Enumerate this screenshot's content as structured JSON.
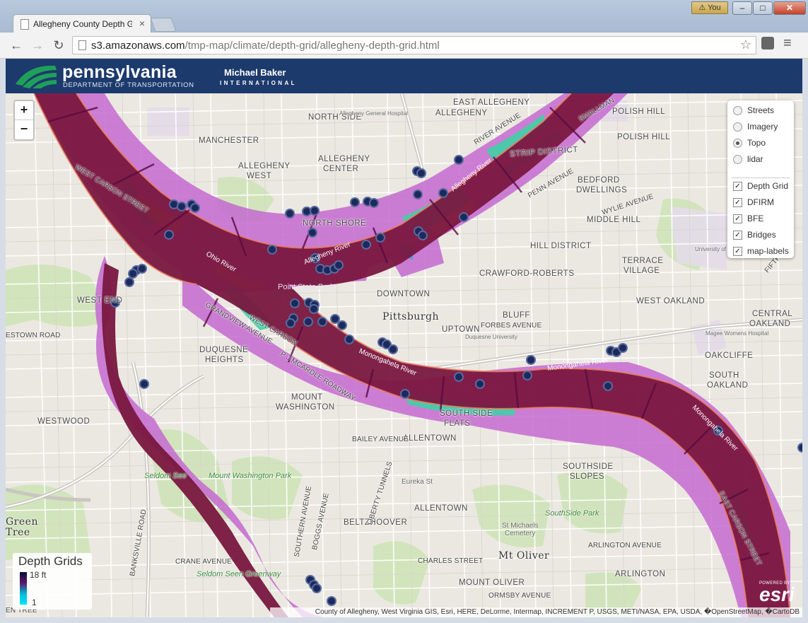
{
  "browser": {
    "tab_title": "Allegheny County Depth G",
    "profile_label": "You",
    "url_host": "s3.amazonaws.com",
    "url_path": "/tmp-map/climate/depth-grid/allegheny-depth-grid.html"
  },
  "banner": {
    "penndot_name": "pennsylvania",
    "penndot_dept": "DEPARTMENT OF TRANSPORTATION",
    "partner_name": "Michael Baker",
    "partner_sub": "INTERNATIONAL"
  },
  "zoom": {
    "in_label": "+",
    "out_label": "−"
  },
  "layers": {
    "basemaps": [
      {
        "label": "Streets",
        "selected": false
      },
      {
        "label": "Imagery",
        "selected": false
      },
      {
        "label": "Topo",
        "selected": true
      },
      {
        "label": "lidar",
        "selected": false
      }
    ],
    "overlays": [
      {
        "label": "Depth Grid",
        "checked": true
      },
      {
        "label": "DFIRM",
        "checked": true
      },
      {
        "label": "BFE",
        "checked": true
      },
      {
        "label": "Bridges",
        "checked": true
      },
      {
        "label": "map-labels",
        "checked": true
      }
    ]
  },
  "legend": {
    "title": "Depth Grids",
    "max": "18 ft",
    "min": "1"
  },
  "attribution": "County of Allegheny, West Virginia GIS, Esri, HERE, DeLorme, Intermap, INCREMENT P, USGS, METI/NASA, EPA, USDA, �OpenStreetMap, �CartoDB",
  "esri": {
    "powered": "POWERED BY",
    "word": "esri"
  },
  "map_labels": {
    "north_side": "NORTH SIDE",
    "east_allegheny": "EAST ALLEGHENY",
    "east_allegheny2": "ALLEGHENY",
    "polish_hill": "POLISH HILL",
    "polish_hill2": "POLISH HILL",
    "manchester": "MANCHESTER",
    "allegheny_center": "ALLEGHENY",
    "allegheny_center2": "CENTER",
    "allegheny_west": "ALLEGHENY",
    "allegheny_west2": "WEST",
    "strip_district": "STRIP DISTRICT",
    "bedford": "BEDFORD",
    "bedford2": "DWELLINGS",
    "wylie": "WYLIE AVENUE",
    "middle_hill": "MIDDLE HILL",
    "north_shore": "NORTH SHORE",
    "hill_district": "HILL DISTRICT",
    "crawford": "CRAWFORD-ROBERTS",
    "terrace": "TERRACE",
    "terrace2": "VILLAGE",
    "downtown": "DOWNTOWN",
    "pittsburgh": "Pittsburgh",
    "bluff": "BLUFF",
    "uptown": "UPTOWN",
    "forbes": "FORBES AVENUE",
    "west_oakland": "WEST OAKLAND",
    "central": "CENTRAL",
    "oakland_c": "OAKLAND",
    "oakcliffe": "OAKCLIFFE",
    "south_oakland": "SOUTH",
    "south_oakland2": "OAKLAND",
    "west_end": "WEST END",
    "duquesne": "DUQUESNE",
    "duquesne2": "HEIGHTS",
    "mount_washington": "MOUNT",
    "mount_washington2": "WASHINGTON",
    "westwood": "WESTWOOD",
    "southside_flats": "SOUTH SIDE",
    "southside_flats2": "FLATS",
    "allentown": "ALLENTOWN",
    "bailey": "BAILEY AVENUE",
    "southside_slopes": "SOUTHSIDE",
    "southside_slopes2": "SLOPES",
    "allentown2": "ALLENTOWN",
    "beltzhoover": "BELTZHOOVER",
    "mt_oliver": "Mt Oliver",
    "charles": "CHARLES STREET",
    "arlington_ave": "ARLINGTON AVENUE",
    "arlington": "ARLINGTON",
    "mount_oliver": "MOUNT OLIVER",
    "ormsby": "ORMSBY AVENUE",
    "crane": "CRANE AVENUE",
    "green_tree": "Green",
    "green_tree2": "Tree",
    "estown": "ESTOWN ROAD",
    "west_carson": "WEST CARSON STREET",
    "west_carson2": "WEST CARSON",
    "grandview": "GRANDVIEW AVENUE",
    "mccardle": "P J MCARDLE ROADWAY",
    "east_carson": "EAST CARSON STREET",
    "river_ave": "RIVER AVENUE",
    "smallman": "SMALLMAN",
    "penn_ave": "PENN AVENUE",
    "fifth": "FIFTH AV",
    "ohio_river": "Ohio River",
    "allegheny_river": "Allegheny River",
    "allegheny_river2": "Allegheny River",
    "mon_river": "Monongahela River",
    "mon_river2": "Monongahela River",
    "mon_river3": "Monongahela River",
    "point_state": "Point State Park",
    "seldom_see": "Seldom See",
    "mount_wash_park": "Mount Washington Park",
    "seldom_seen_green": "Seldom Seen Greenway",
    "southside_park": "SouthSide Park",
    "st_michaels": "St Michaels",
    "cemetery": "Cemetery",
    "banksville": "BANKSVILLE ROAD",
    "southern": "SOUTHERN AVENUE",
    "boggs": "BOGGS AVENUE",
    "liberty": "LIBERTY TUNNELS",
    "eureka": "Eureka St",
    "entree": "EN TREE",
    "general_hospital": "Allegheny General Hospital",
    "university": "University of Pittsburgh",
    "duquesne_univ": "Duquesne University",
    "magee": "Magee Womens Hospital"
  }
}
